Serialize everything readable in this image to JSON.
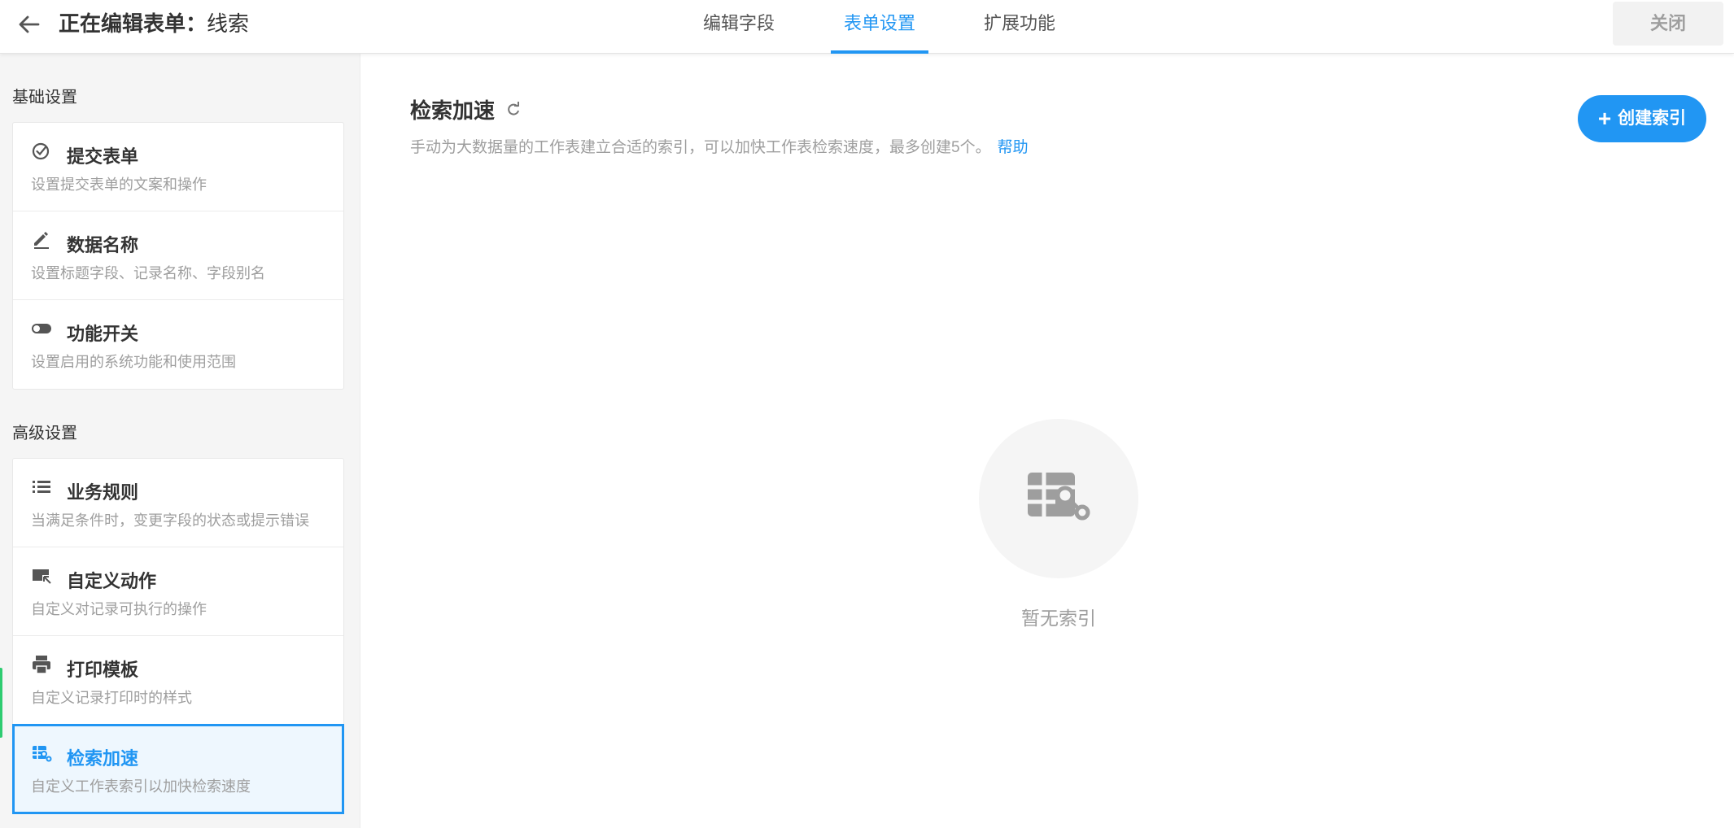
{
  "header": {
    "title_prefix": "正在编辑表单",
    "title_sep": "：",
    "title_name": "线索",
    "tabs": [
      {
        "label": "编辑字段"
      },
      {
        "label": "表单设置"
      },
      {
        "label": "扩展功能"
      }
    ],
    "active_tab": "表单设置",
    "close_label": "关闭"
  },
  "sidebar": {
    "basic_title": "基础设置",
    "basic_items": [
      {
        "icon": "check-circle-icon",
        "label": "提交表单",
        "desc": "设置提交表单的文案和操作"
      },
      {
        "icon": "edit-pen-icon",
        "label": "数据名称",
        "desc": "设置标题字段、记录名称、字段别名"
      },
      {
        "icon": "toggle-icon",
        "label": "功能开关",
        "desc": "设置启用的系统功能和使用范围"
      }
    ],
    "advanced_title": "高级设置",
    "advanced_items": [
      {
        "icon": "list-icon",
        "label": "业务规则",
        "desc": "当满足条件时，变更字段的状态或提示错误"
      },
      {
        "icon": "custom-action-icon",
        "label": "自定义动作",
        "desc": "自定义对记录可执行的操作"
      },
      {
        "icon": "print-icon",
        "label": "打印模板",
        "desc": "自定义记录打印时的样式"
      },
      {
        "icon": "index-icon",
        "label": "检索加速",
        "desc": "自定义工作表索引以加快检索速度"
      }
    ],
    "active_item": "检索加速"
  },
  "main": {
    "title": "检索加速",
    "description": "手动为大数据量的工作表建立合适的索引，可以加快工作表检索速度，最多创建5个。",
    "help_label": "帮助",
    "create_label": "创建索引",
    "empty_text": "暂无索引"
  },
  "colors": {
    "accent": "#2196f3",
    "active_bg": "#eef7fe",
    "sidebar_bg": "#f5f5f5",
    "muted_text": "#9e9e9e"
  }
}
